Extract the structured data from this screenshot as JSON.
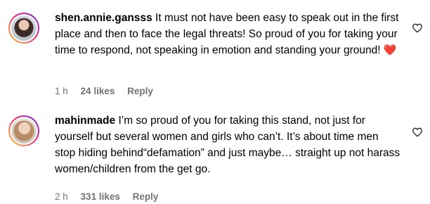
{
  "comments": [
    {
      "username": "shen.annie.gansss",
      "text": "It must not have been easy to speak out in the first place and then to face the legal threats! So proud of you for taking your time to respond, not speaking in emotion and standing your ground!",
      "emoji": "❤️",
      "time": "1 h",
      "likes": "24 likes",
      "reply_label": "Reply"
    },
    {
      "username": "mahinmade",
      "text": "I’m so proud of you for taking this stand, not just for yourself but several women and girls who can’t. It’s about time men stop hiding behind“defamation” and just maybe… straight up not harass women/children from the get go.",
      "time": "2 h",
      "likes": "331 likes",
      "reply_label": "Reply"
    }
  ],
  "colors": {
    "text": "#000000",
    "meta": "#737373",
    "heart": "#e0245e"
  },
  "icons": {
    "like": "heart-outline-icon"
  }
}
